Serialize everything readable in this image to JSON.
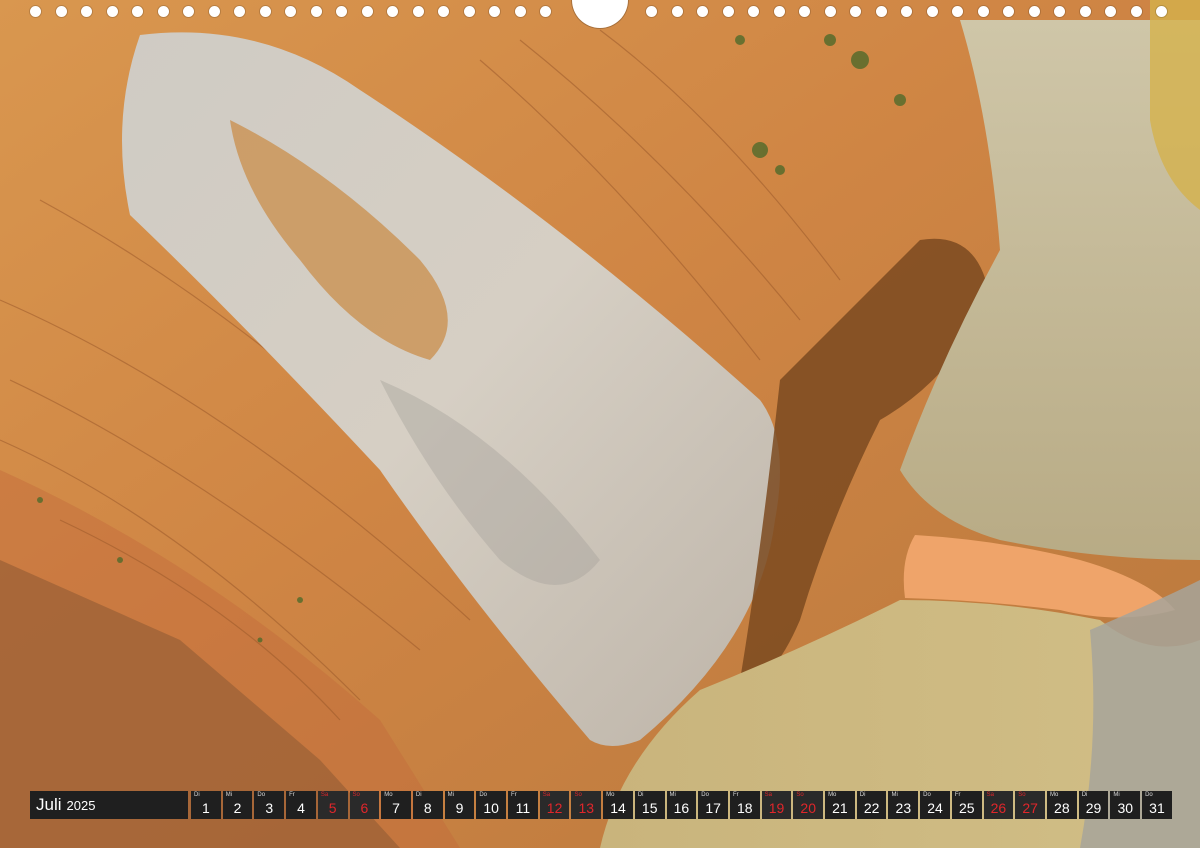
{
  "calendar": {
    "month": "Juli",
    "year": "2025",
    "days": [
      {
        "n": "1",
        "wd": "Di",
        "we": false
      },
      {
        "n": "2",
        "wd": "Mi",
        "we": false
      },
      {
        "n": "3",
        "wd": "Do",
        "we": false
      },
      {
        "n": "4",
        "wd": "Fr",
        "we": false
      },
      {
        "n": "5",
        "wd": "Sa",
        "we": true
      },
      {
        "n": "6",
        "wd": "So",
        "we": true
      },
      {
        "n": "7",
        "wd": "Mo",
        "we": false
      },
      {
        "n": "8",
        "wd": "Di",
        "we": false
      },
      {
        "n": "9",
        "wd": "Mi",
        "we": false
      },
      {
        "n": "10",
        "wd": "Do",
        "we": false
      },
      {
        "n": "11",
        "wd": "Fr",
        "we": false
      },
      {
        "n": "12",
        "wd": "Sa",
        "we": true
      },
      {
        "n": "13",
        "wd": "So",
        "we": true
      },
      {
        "n": "14",
        "wd": "Mo",
        "we": false
      },
      {
        "n": "15",
        "wd": "Di",
        "we": false
      },
      {
        "n": "16",
        "wd": "Mi",
        "we": false
      },
      {
        "n": "17",
        "wd": "Do",
        "we": false
      },
      {
        "n": "18",
        "wd": "Fr",
        "we": false
      },
      {
        "n": "19",
        "wd": "Sa",
        "we": true
      },
      {
        "n": "20",
        "wd": "So",
        "we": true
      },
      {
        "n": "21",
        "wd": "Mo",
        "we": false
      },
      {
        "n": "22",
        "wd": "Di",
        "we": false
      },
      {
        "n": "23",
        "wd": "Mi",
        "we": false
      },
      {
        "n": "24",
        "wd": "Do",
        "we": false
      },
      {
        "n": "25",
        "wd": "Fr",
        "we": false
      },
      {
        "n": "26",
        "wd": "Sa",
        "we": true
      },
      {
        "n": "27",
        "wd": "So",
        "we": true
      },
      {
        "n": "28",
        "wd": "Mo",
        "we": false
      },
      {
        "n": "29",
        "wd": "Di",
        "we": false
      },
      {
        "n": "30",
        "wd": "Mi",
        "we": false
      },
      {
        "n": "31",
        "wd": "Do",
        "we": false
      }
    ]
  },
  "colors": {
    "bar": "#1f1f1f",
    "weekend": "#e0262b",
    "hole": "#ffffff"
  }
}
